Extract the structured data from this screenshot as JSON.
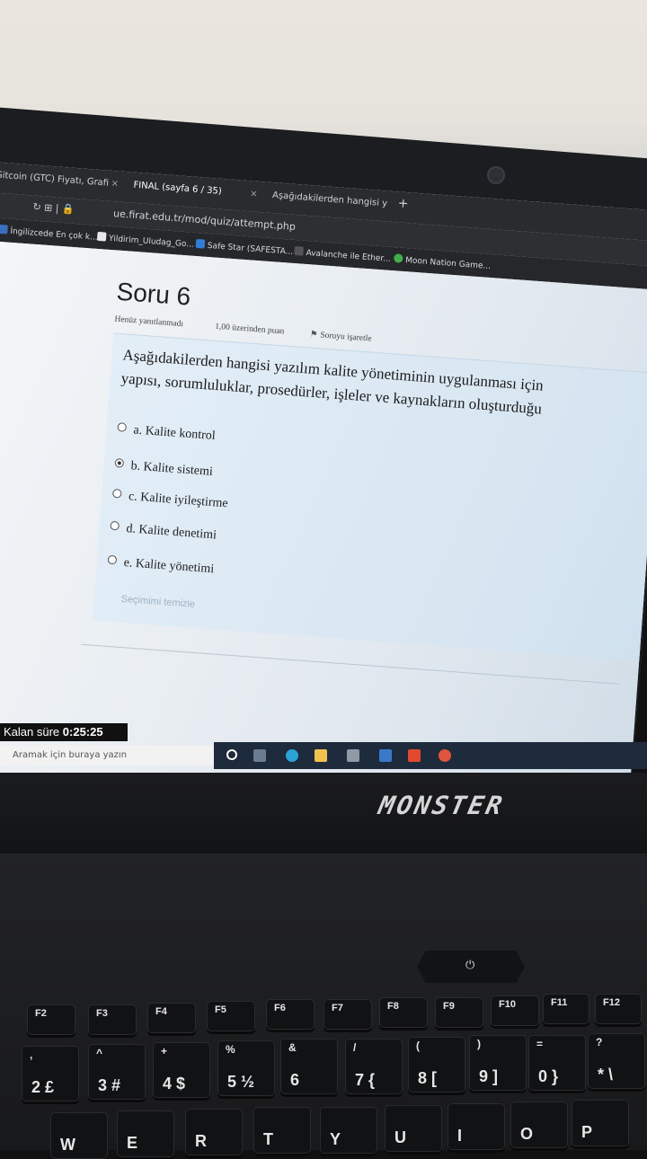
{
  "browser": {
    "tabs": [
      {
        "label": "Gitcoin (GTC) Fiyatı, Grafi",
        "active": false
      },
      {
        "label": "FINAL (sayfa 6 / 35)",
        "active": true
      },
      {
        "label": "Aşağıdakilerden hangisi y",
        "active": false
      }
    ],
    "new_tab": "+",
    "url": "ue.firat.edu.tr/mod/quiz/attempt.php",
    "bookmarks": [
      "İngilizcede En çok k...",
      "Yildirim_Uludag_Go...",
      "Safe Star (SAFESTA...",
      "Avalanche ile Ether...",
      "Moon Nation Game..."
    ]
  },
  "quiz": {
    "title": "Soru 6",
    "status": "Henüz yanıtlanmadı",
    "points": "1,00 üzerinden puan",
    "flag_label": "Soruyu işaretle",
    "question_line1": "Aşağıdakilerden hangisi yazılım kalite yönetiminin uygulanması için",
    "question_line2": "yapısı, sorumluluklar, prosedürler, işleler ve kaynakların oluşturduğu",
    "options": [
      {
        "letter": "a.",
        "text": "Kalite kontrol",
        "selected": false
      },
      {
        "letter": "b.",
        "text": "Kalite sistemi",
        "selected": true
      },
      {
        "letter": "c.",
        "text": "Kalite iyileştirme",
        "selected": false
      },
      {
        "letter": "d.",
        "text": "Kalite denetimi",
        "selected": false
      },
      {
        "letter": "e.",
        "text": "Kalite yönetimi",
        "selected": false
      }
    ],
    "clear_choice": "Seçimimi temizle"
  },
  "timer": {
    "label": "Kalan süre",
    "value": "0:25:25"
  },
  "taskbar": {
    "search_placeholder": "Aramak için buraya yazın"
  },
  "laptop": {
    "brand": "MONSTER"
  },
  "keyboard": {
    "fkeys": [
      "F2",
      "F3",
      "F4",
      "F5",
      "F6",
      "F7",
      "F8",
      "F9",
      "F10",
      "F11",
      "F12"
    ],
    "number_row": [
      {
        "top": ",",
        "main": "2 £"
      },
      {
        "top": "^",
        "main": "3 #"
      },
      {
        "top": "+",
        "main": "4 $"
      },
      {
        "top": "%",
        "main": "5 ½"
      },
      {
        "top": "&",
        "main": "6"
      },
      {
        "top": "/",
        "main": "7 {"
      },
      {
        "top": "(",
        "main": "8 ["
      },
      {
        "top": ")",
        "main": "9 ]"
      },
      {
        "top": "=",
        "main": "0 }"
      },
      {
        "top": "?",
        "main": "* \\"
      }
    ],
    "letter_row": [
      "W",
      "E",
      "R",
      "T",
      "Y",
      "U",
      "I",
      "O",
      "P"
    ]
  }
}
